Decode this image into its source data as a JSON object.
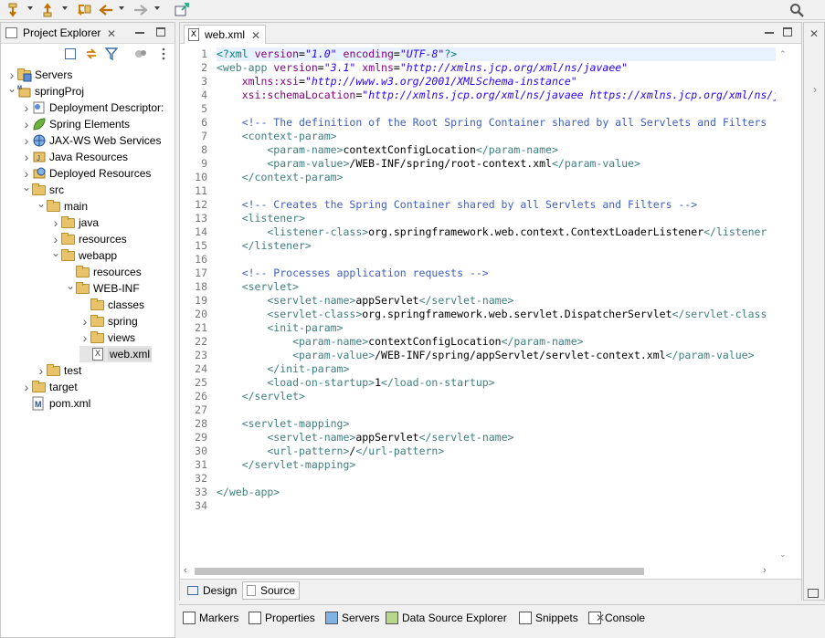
{
  "toolbar": {
    "icons": [
      "annotation-down-icon",
      "annotation-up-icon",
      "last-edit-icon",
      "back-icon",
      "forward-icon",
      "pin-editor-icon",
      "search-icon"
    ]
  },
  "project_explorer": {
    "title": "Project Explorer",
    "tree": [
      {
        "label": "Servers",
        "indent": 0,
        "expander": "closed",
        "icon": "servers"
      },
      {
        "label": "springProj",
        "indent": 0,
        "expander": "open",
        "icon": "maven-project"
      },
      {
        "label": "Deployment Descriptor:",
        "indent": 1,
        "expander": "closed",
        "icon": "descriptor"
      },
      {
        "label": "Spring Elements",
        "indent": 1,
        "expander": "closed",
        "icon": "spring-leaf"
      },
      {
        "label": "JAX-WS Web Services",
        "indent": 1,
        "expander": "closed",
        "icon": "webservices"
      },
      {
        "label": "Java Resources",
        "indent": 1,
        "expander": "closed",
        "icon": "java-resources"
      },
      {
        "label": "Deployed Resources",
        "indent": 1,
        "expander": "closed",
        "icon": "deployed"
      },
      {
        "label": "src",
        "indent": 1,
        "expander": "open",
        "icon": "folder"
      },
      {
        "label": "main",
        "indent": 2,
        "expander": "open",
        "icon": "folder"
      },
      {
        "label": "java",
        "indent": 3,
        "expander": "closed",
        "icon": "folder"
      },
      {
        "label": "resources",
        "indent": 3,
        "expander": "closed",
        "icon": "folder"
      },
      {
        "label": "webapp",
        "indent": 3,
        "expander": "open",
        "icon": "folder"
      },
      {
        "label": "resources",
        "indent": 4,
        "expander": "none",
        "icon": "folder"
      },
      {
        "label": "WEB-INF",
        "indent": 4,
        "expander": "open",
        "icon": "folder"
      },
      {
        "label": "classes",
        "indent": 5,
        "expander": "none",
        "icon": "folder"
      },
      {
        "label": "spring",
        "indent": 5,
        "expander": "closed",
        "icon": "folder"
      },
      {
        "label": "views",
        "indent": 5,
        "expander": "closed",
        "icon": "folder"
      },
      {
        "label": "web.xml",
        "indent": 5,
        "expander": "none",
        "icon": "xml",
        "selected": true
      },
      {
        "label": "test",
        "indent": 2,
        "expander": "closed",
        "icon": "folder"
      },
      {
        "label": "target",
        "indent": 1,
        "expander": "closed",
        "icon": "folder"
      },
      {
        "label": "pom.xml",
        "indent": 1,
        "expander": "none",
        "icon": "maven-pom"
      }
    ]
  },
  "editor": {
    "tab_label": "web.xml",
    "bottom_tabs": [
      {
        "label": "Design"
      },
      {
        "label": "Source",
        "active": true
      }
    ],
    "lines": [
      [
        {
          "t": "<?",
          "c": "pi"
        },
        {
          "t": "xml ",
          "c": "pi"
        },
        {
          "t": "version",
          "c": "at"
        },
        {
          "t": "=",
          "c": "tx"
        },
        {
          "t": "\"1.0\"",
          "c": "av"
        },
        {
          "t": " ",
          "c": "tx"
        },
        {
          "t": "encoding",
          "c": "at"
        },
        {
          "t": "=",
          "c": "tx"
        },
        {
          "t": "\"UTF-8\"",
          "c": "av"
        },
        {
          "t": "?>",
          "c": "pi"
        }
      ],
      [
        {
          "t": "<web-app ",
          "c": "tg"
        },
        {
          "t": "version",
          "c": "at"
        },
        {
          "t": "=",
          "c": "tx"
        },
        {
          "t": "\"3.1\"",
          "c": "av"
        },
        {
          "t": " ",
          "c": "tx"
        },
        {
          "t": "xmlns",
          "c": "at"
        },
        {
          "t": "=",
          "c": "tx"
        },
        {
          "t": "\"http://xmlns.jcp.org/xml/ns/javaee\"",
          "c": "av"
        }
      ],
      [
        {
          "t": "    ",
          "c": "tx"
        },
        {
          "t": "xmlns:xsi",
          "c": "at"
        },
        {
          "t": "=",
          "c": "tx"
        },
        {
          "t": "\"http://www.w3.org/2001/XMLSchema-instance\"",
          "c": "av"
        }
      ],
      [
        {
          "t": "    ",
          "c": "tx"
        },
        {
          "t": "xsi:schemaLocation",
          "c": "at"
        },
        {
          "t": "=",
          "c": "tx"
        },
        {
          "t": "\"http://xmlns.jcp.org/xml/ns/javaee https://xmlns.jcp.org/xml/ns/j",
          "c": "av"
        }
      ],
      [],
      [
        {
          "t": "    <!-- The definition of the Root Spring Container shared by all Servlets and Filters",
          "c": "cm"
        }
      ],
      [
        {
          "t": "    <context-param>",
          "c": "tg"
        }
      ],
      [
        {
          "t": "        <param-name>",
          "c": "tg"
        },
        {
          "t": "contextConfigLocation",
          "c": "tx"
        },
        {
          "t": "</param-name>",
          "c": "tg"
        }
      ],
      [
        {
          "t": "        <param-value>",
          "c": "tg"
        },
        {
          "t": "/WEB-INF/spring/root-context.xml",
          "c": "tx"
        },
        {
          "t": "</param-value>",
          "c": "tg"
        }
      ],
      [
        {
          "t": "    </context-param>",
          "c": "tg"
        }
      ],
      [],
      [
        {
          "t": "    <!-- Creates the Spring Container shared by all Servlets and Filters -->",
          "c": "cm"
        }
      ],
      [
        {
          "t": "    <listener>",
          "c": "tg"
        }
      ],
      [
        {
          "t": "        <listener-class>",
          "c": "tg"
        },
        {
          "t": "org.springframework.web.context.ContextLoaderListener",
          "c": "tx"
        },
        {
          "t": "</listener",
          "c": "tg"
        }
      ],
      [
        {
          "t": "    </listener>",
          "c": "tg"
        }
      ],
      [],
      [
        {
          "t": "    <!-- Processes application requests -->",
          "c": "cm"
        }
      ],
      [
        {
          "t": "    <servlet>",
          "c": "tg"
        }
      ],
      [
        {
          "t": "        <servlet-name>",
          "c": "tg"
        },
        {
          "t": "appServlet",
          "c": "tx"
        },
        {
          "t": "</servlet-name>",
          "c": "tg"
        }
      ],
      [
        {
          "t": "        <servlet-class>",
          "c": "tg"
        },
        {
          "t": "org.springframework.web.servlet.DispatcherServlet",
          "c": "tx"
        },
        {
          "t": "</servlet-class",
          "c": "tg"
        }
      ],
      [
        {
          "t": "        <init-param>",
          "c": "tg"
        }
      ],
      [
        {
          "t": "            <param-name>",
          "c": "tg"
        },
        {
          "t": "contextConfigLocation",
          "c": "tx"
        },
        {
          "t": "</param-name>",
          "c": "tg"
        }
      ],
      [
        {
          "t": "            <param-value>",
          "c": "tg"
        },
        {
          "t": "/WEB-INF/spring/appServlet/servlet-context.xml",
          "c": "tx"
        },
        {
          "t": "</param-value>",
          "c": "tg"
        }
      ],
      [
        {
          "t": "        </init-param>",
          "c": "tg"
        }
      ],
      [
        {
          "t": "        <load-on-startup>",
          "c": "tg"
        },
        {
          "t": "1",
          "c": "tx"
        },
        {
          "t": "</load-on-startup>",
          "c": "tg"
        }
      ],
      [
        {
          "t": "    </servlet>",
          "c": "tg"
        }
      ],
      [],
      [
        {
          "t": "    <servlet-mapping>",
          "c": "tg"
        }
      ],
      [
        {
          "t": "        <servlet-name>",
          "c": "tg"
        },
        {
          "t": "appServlet",
          "c": "tx"
        },
        {
          "t": "</servlet-name>",
          "c": "tg"
        }
      ],
      [
        {
          "t": "        <url-pattern>",
          "c": "tg"
        },
        {
          "t": "/",
          "c": "tx"
        },
        {
          "t": "</url-pattern>",
          "c": "tg"
        }
      ],
      [
        {
          "t": "    </servlet-mapping>",
          "c": "tg"
        }
      ],
      [],
      [
        {
          "t": "</web-app>",
          "c": "tg"
        }
      ],
      []
    ]
  },
  "bottom_panel": {
    "tabs": [
      {
        "label": "Markers",
        "icon": "markers-icon"
      },
      {
        "label": "Properties",
        "icon": "properties-icon"
      },
      {
        "label": "Servers",
        "icon": "servers-icon"
      },
      {
        "label": "Data Source Explorer",
        "icon": "data-source-icon"
      },
      {
        "label": "Snippets",
        "icon": "snippets-icon"
      },
      {
        "label": "Console",
        "icon": "console-icon",
        "active": true
      }
    ]
  },
  "colors": {
    "tag": "#3f7f7f",
    "attribute": "#7f007f",
    "value": "#2a00ff",
    "comment": "#3f5fbf",
    "pi": "#008080",
    "line_highlight": "#e8f2fe",
    "folder": "#e8c36a"
  }
}
